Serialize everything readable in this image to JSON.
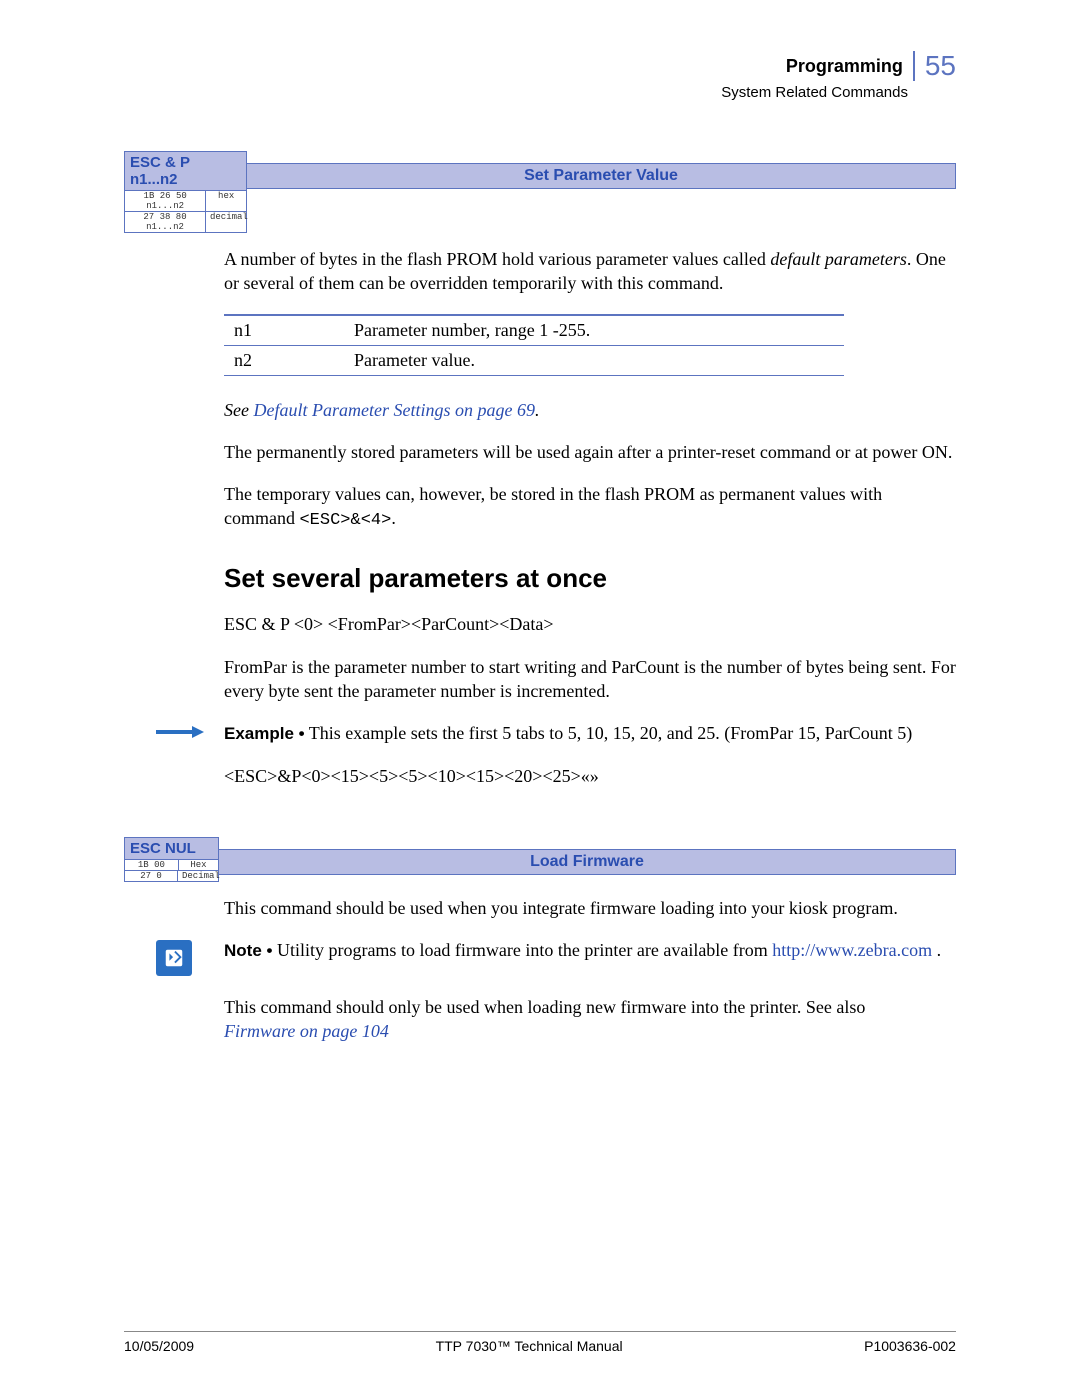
{
  "header": {
    "chapter": "Programming",
    "page_number": "55",
    "section": "System Related Commands"
  },
  "cmd1": {
    "title": "ESC & P n1...n2",
    "hex_value": "1B 26 50 n1...n2",
    "hex_label": "hex",
    "dec_value": "27 38 80 n1...n2",
    "dec_label": "decimal",
    "bar_title": "Set Parameter Value"
  },
  "body": {
    "p1a": "A number of bytes in the flash PROM hold various parameter values called ",
    "p1b_italic": "default parameters",
    "p1c": ". One or several of them can be overridden temporarily with this command.",
    "table": {
      "r1c1": "n1",
      "r1c2": "Parameter number, range 1 -255.",
      "r2c1": "n2",
      "r2c2": "Parameter value."
    },
    "see_prefix": "See ",
    "see_link": "Default Parameter Settings",
    "see_suffix": " on page 69",
    "see_dot": ".",
    "p2": "The permanently stored parameters will be used again after a printer-reset command or at power ON.",
    "p3a": "The temporary values can, however, be stored in the flash PROM as permanent values with command ",
    "p3b_mono": "<ESC>&<4>",
    "p3c": "."
  },
  "section2": {
    "heading": "Set several parameters at once",
    "p1": "ESC & P <0> <FromPar><ParCount><Data>",
    "p2": "FromPar is the parameter number to start writing and ParCount is the number of bytes being sent. For every byte sent the parameter number is incremented.",
    "example_label": "Example •",
    "example_text": " This example sets the first 5 tabs to 5, 10, 15, 20, and 25. (FromPar 15, ParCount 5)",
    "example_code": "<ESC>&P<0><15><5><5><10><15><20><25>«»"
  },
  "cmd2": {
    "title": "ESC NUL",
    "hex_value": "1B 00",
    "hex_label": "Hex",
    "dec_value": "27 0",
    "dec_label": "Decimal",
    "bar_title": "Load Firmware"
  },
  "body2": {
    "p1": "This command should be used when you integrate firmware loading into your kiosk program.",
    "note_label": "Note •",
    "note_text": " Utility programs to load firmware into the printer are available from ",
    "note_link": "http://www.zebra.com",
    "note_dot": " .",
    "p2a": "This command should only be used when loading new firmware into the printer. See also ",
    "p2b_link": "Firmware",
    "p2c": " on page 104"
  },
  "footer": {
    "left": "10/05/2009",
    "center": "TTP 7030™ Technical Manual",
    "right": "P1003636-002"
  }
}
